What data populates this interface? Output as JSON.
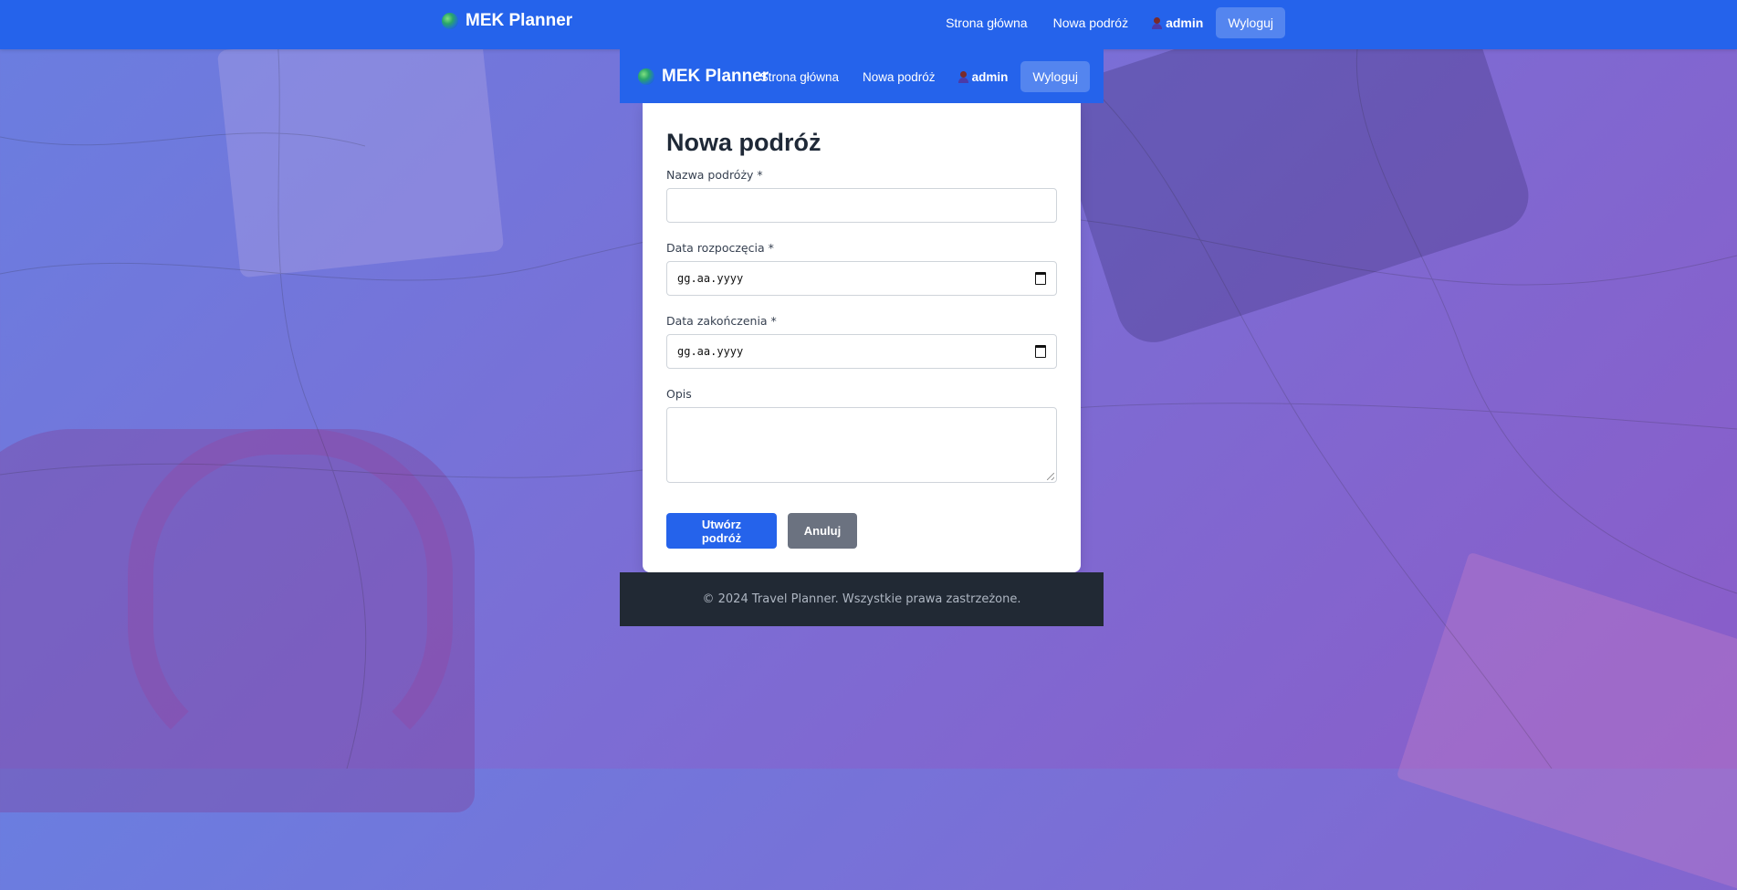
{
  "app": {
    "brand": "MEK Planner"
  },
  "topnav": {
    "home_label": "Strona główna",
    "new_trip_label": "Nowa podróż",
    "user_name": "admin",
    "logout_label": "Wyloguj"
  },
  "inner_nav": {
    "brand": "MEK Planner",
    "home_label": "Strona główna",
    "new_trip_label": "Nowa podróż",
    "user_name": "admin",
    "logout_label": "Wyloguj"
  },
  "form": {
    "title": "Nowa podróż",
    "fields": [
      {
        "label": "Nazwa podróży *",
        "value": ""
      },
      {
        "label": "Data rozpoczęcia *",
        "placeholder": "gg.aa.yyyy"
      },
      {
        "label": "Data zakończenia *",
        "placeholder": "gg.aa.yyyy"
      },
      {
        "label": "Opis",
        "value": ""
      }
    ],
    "submit_label": "Utwórz podróż",
    "cancel_label": "Anuluj"
  },
  "footer": {
    "text": "© 2024 Travel Planner. Wszystkie prawa zastrzeżone."
  },
  "colors": {
    "primary": "#2563eb",
    "secondary": "#6b7280",
    "footer_bg": "#212934"
  },
  "icons": {
    "brand": "globe-icon",
    "user": "user-icon",
    "date": "calendar-icon"
  }
}
